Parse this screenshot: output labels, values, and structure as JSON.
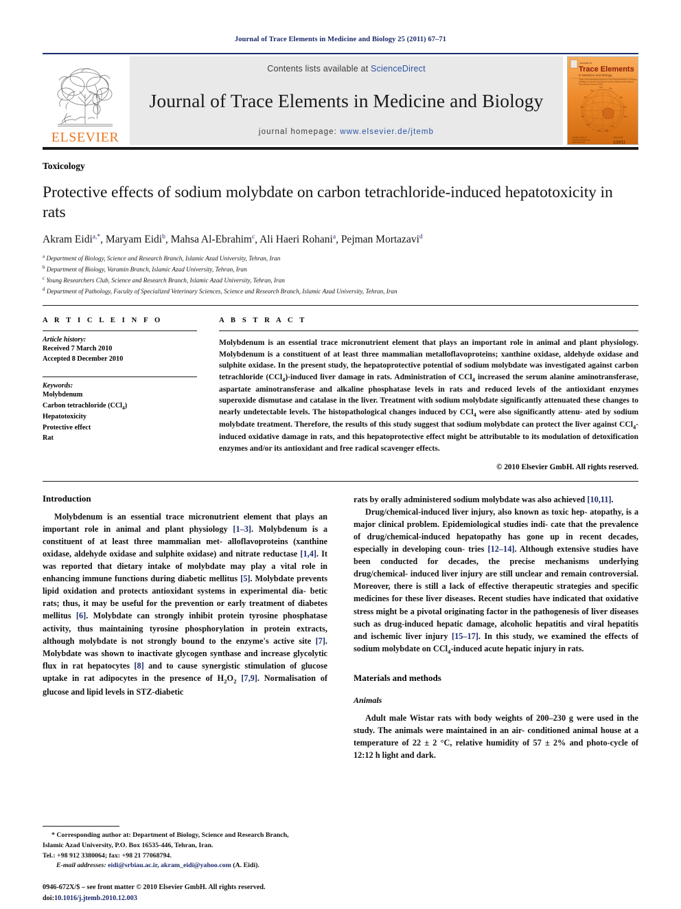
{
  "running_head": "Journal of Trace Elements in Medicine and Biology 25 (2011) 67–71",
  "masthead": {
    "publisher_name": "ELSEVIER",
    "contents_prefix": "Contents lists available at ",
    "contents_link": "ScienceDirect",
    "journal_title": "Journal of Trace Elements in Medicine and Biology",
    "homepage_label": "journal homepage:",
    "homepage_url": "www.elsevier.de/jtemb",
    "cover": {
      "journal_of": "Journal of",
      "title": "Trace Elements",
      "subtitle": "in Medicine and Biology",
      "blurb": "Organ of the International Society for Trace Element Research in Humans (ISTERH), the Nordic Trace Element Society (NTES) and the Hellenic Trace Element Society (HTES)",
      "editors_line": "Editor-in-Chief",
      "volume_label": "Volume 25",
      "issue_label": "1/2011",
      "foot_left": "Available online at\nwww.sciencedirect.com\nISSN 0946-672X"
    }
  },
  "section_label": "Toxicology",
  "title": "Protective effects of sodium molybdate on carbon tetrachloride-induced hepatotoxicity in rats",
  "authors": [
    {
      "name": "Akram Eidi",
      "marks": "a,*"
    },
    {
      "name": "Maryam Eidi",
      "marks": "b"
    },
    {
      "name": "Mahsa Al-Ebrahim",
      "marks": "c"
    },
    {
      "name": "Ali Haeri Rohani",
      "marks": "a"
    },
    {
      "name": "Pejman Mortazavi",
      "marks": "d"
    }
  ],
  "affiliations": [
    {
      "mark": "a",
      "text": "Department of Biology, Science and Research Branch, Islamic Azad University, Tehran, Iran"
    },
    {
      "mark": "b",
      "text": "Department of Biology, Varamin Branch, Islamic Azad University, Tehran, Iran"
    },
    {
      "mark": "c",
      "text": "Young Researchers Club, Science and Research Branch, Islamic Azad University, Tehran, Iran"
    },
    {
      "mark": "d",
      "text": "Department of Pathology, Faculty of Specialized Veterinary Sciences, Science and Research Branch, Islamic Azad University, Tehran, Iran"
    }
  ],
  "article_info": {
    "heading": "A R T I C L E   I N F O",
    "history_label": "Article history:",
    "history": [
      "Received 7 March 2010",
      "Accepted 8 December 2010"
    ],
    "keywords_label": "Keywords:",
    "keywords": [
      "Molybdenum",
      "Carbon tetrachloride (CCl4)",
      "Hepatotoxicity",
      "Protective effect",
      "Rat"
    ]
  },
  "abstract": {
    "heading": "A B S T R A C T",
    "text": "Molybdenum is an essential trace micronutrient element that plays an important role in animal and plant physiology. Molybdenum is a constituent of at least three mammalian metalloflavoproteins; xanthine oxidase, aldehyde oxidase and sulphite oxidase. In the present study, the hepatoprotective potential of sodium molybdate was investigated against carbon tetrachloride (CCl4)-induced liver damage in rats. Administration of CCl4 increased the serum alanine aminotransferase, aspartate aminotransferase and alkaline phosphatase levels in rats and reduced levels of the antioxidant enzymes superoxide dismutase and catalase in the liver. Treatment with sodium molybdate significantly attenuated these changes to nearly undetectable levels. The histopathological changes induced by CCl4 were also significantly attenuated by sodium molybdate treatment. Therefore, the results of this study suggest that sodium molybdate can protect the liver against CCl4-induced oxidative damage in rats, and this hepatoprotective effect might be attributable to its modulation of detoxification enzymes and/or its antioxidant and free radical scavenger effects.",
    "copyright": "© 2010 Elsevier GmbH. All rights reserved."
  },
  "body": {
    "introduction_heading": "Introduction",
    "intro_p1": "Molybdenum is an essential trace micronutrient element that plays an important role in animal and plant physiology [1–3]. Molybdenum is a constituent of at least three mammalian metalloflavoproteins (xanthine oxidase, aldehyde oxidase and sulphite oxidase) and nitrate reductase [1,4]. It was reported that dietary intake of molybdate may play a vital role in enhancing immune functions during diabetic mellitus [5]. Molybdate prevents lipid oxidation and protects antioxidant systems in experimental diabetic rats; thus, it may be useful for the prevention or early treatment of diabetes mellitus [6]. Molybdate can strongly inhibit protein tyrosine phosphatase activity, thus maintaining tyrosine phosphorylation in protein extracts, although molybdate is not strongly bound to the enzyme's active site [7]. Molybdate was shown to inactivate glycogen synthase and increase glycolytic flux in rat hepatocytes [8] and to cause synergistic stimulation of glucose uptake in rat adipocytes in the presence of H2O2 [7,9]. Normalisation of glucose and lipid levels in STZ-diabetic rats by orally administered sodium molybdate was also achieved [10,11].",
    "intro_p2": "Drug/chemical-induced liver injury, also known as toxic hepatopathy, is a major clinical problem. Epidemiological studies indicate that the prevalence of drug/chemical-induced hepatopathy has gone up in recent decades, especially in developing countries [12–14]. Although extensive studies have been conducted for decades, the precise mechanisms underlying drug/chemical-induced liver injury are still unclear and remain controversial. Moreover, there is still a lack of effective therapeutic strategies and specific medicines for these liver diseases. Recent studies have indicated that oxidative stress might be a pivotal originating factor in the pathogenesis of liver diseases such as drug-induced hepatic damage, alcoholic hepatitis and viral hepatitis and ischemic liver injury [15–17]. In this study, we examined the effects of sodium molybdate on CCl4-induced acute hepatic injury in rats.",
    "materials_heading": "Materials and methods",
    "animals_heading": "Animals",
    "animals_p1": "Adult male Wistar rats with body weights of 200–230 g were used in the study. The animals were maintained in an air-conditioned animal house at a temperature of 22 ± 2 °C, relative humidity of 57 ± 2% and photo-cycle of 12:12 h light and dark."
  },
  "footnote": {
    "line1": "* Corresponding author at: Department of Biology, Science and Research Branch,",
    "line2": "Islamic Azad University, P.O. Box 16535-446, Tehran, Iran.",
    "line3": "Tel.: +98 912 3380064; fax: +98 21 77068794.",
    "email_label": "E-mail addresses:",
    "email1": "eidi@srbiau.ac.ir",
    "email_sep": ", ",
    "email2": "akram_eidi@yahoo.com",
    "email_suffix": " (A. Eidi)."
  },
  "imprint": {
    "line1": "0946-672X/$ – see front matter © 2010 Elsevier GmbH. All rights reserved.",
    "doi_label": "doi:",
    "doi_value": "10.1016/j.jtemb.2010.12.003"
  },
  "colors": {
    "link": "#2b52a3",
    "reference": "#1b2a6b",
    "elsevier_orange": "#E87722",
    "masthead_band": "#e9e9e9"
  }
}
